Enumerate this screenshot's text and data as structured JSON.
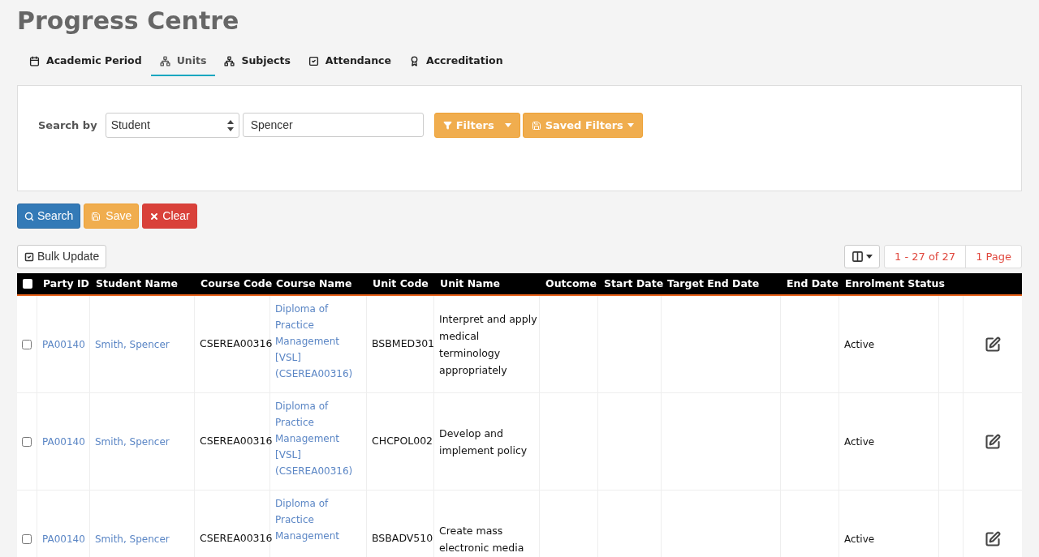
{
  "page_title": "Progress Centre",
  "tabs": [
    {
      "label": "Academic Period",
      "kind": "calendar",
      "selected": false
    },
    {
      "label": "Units",
      "kind": "sitemap",
      "selected": true
    },
    {
      "label": "Subjects",
      "kind": "sitemap",
      "selected": false
    },
    {
      "label": "Attendance",
      "kind": "check",
      "selected": false
    },
    {
      "label": "Accreditation",
      "kind": "award",
      "selected": false
    }
  ],
  "search": {
    "label": "Search by",
    "field": "Student",
    "value": "Spencer",
    "filters_button": "Filters",
    "saved_filters_button": "Saved Filters"
  },
  "actions": {
    "search": "Search",
    "save": "Save",
    "clear": "Clear"
  },
  "bulk_update": "Bulk Update",
  "pagination": {
    "range": "1 - 27 of 27",
    "pages": "1 Page"
  },
  "table": {
    "all_checked": false,
    "columns": [
      "Party ID",
      "Student Name",
      "Course Code",
      "Course Name",
      "Unit Code",
      "Unit Name",
      "Outcome",
      "Start Date",
      "Target End Date",
      "End Date",
      "Enrolment Status"
    ],
    "rows": [
      {
        "checked": false,
        "party_id": "PA00140",
        "student_name": "Smith, Spencer",
        "course_code": "CSEREA00316",
        "course_name": [
          "Diploma of",
          "Practice",
          "Management",
          "[VSL]",
          "(CSEREA00316)"
        ],
        "unit_code": "BSBMED301",
        "unit_name": [
          "Interpret and apply",
          "medical",
          "terminology",
          "appropriately"
        ],
        "status": "Active"
      },
      {
        "checked": false,
        "party_id": "PA00140",
        "student_name": "Smith, Spencer",
        "course_code": "CSEREA00316",
        "course_name": [
          "Diploma of",
          "Practice",
          "Management",
          "[VSL]",
          "(CSEREA00316)"
        ],
        "unit_code": "CHCPOL002",
        "unit_name": [
          "Develop and",
          "implement policy"
        ],
        "status": "Active"
      },
      {
        "checked": false,
        "party_id": "PA00140",
        "student_name": "Smith, Spencer",
        "course_code": "CSEREA00316",
        "course_name": [
          "Diploma of",
          "Practice",
          "Management"
        ],
        "unit_code": "BSBADV510",
        "unit_name": [
          "Create mass",
          "electronic media"
        ],
        "status": "Active"
      }
    ]
  }
}
